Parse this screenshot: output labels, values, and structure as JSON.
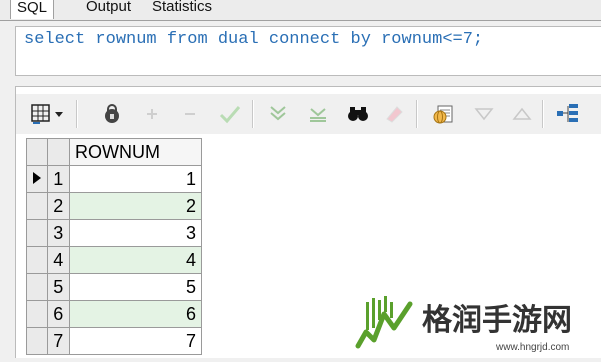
{
  "tabs": [
    {
      "label": "SQL"
    },
    {
      "label": "Output"
    },
    {
      "label": "Statistics"
    }
  ],
  "editor": {
    "text_segments": [
      "select ",
      "rownum ",
      "from ",
      "dual ",
      "connect ",
      "by ",
      "rownum<=7;"
    ]
  },
  "toolbar": {
    "icons": [
      "grid-columns-icon",
      "dropdown-icon",
      "lock-icon",
      "plus-icon",
      "minus-icon",
      "check-icon",
      "filter-down-icon",
      "filter-clear-icon",
      "binoculars-icon",
      "eraser-icon",
      "export-icon",
      "triangle-down-icon",
      "triangle-up-icon",
      "tree-icon"
    ]
  },
  "grid": {
    "column_header": "ROWNUM",
    "rows": [
      {
        "num": "1",
        "value": "1"
      },
      {
        "num": "2",
        "value": "2"
      },
      {
        "num": "3",
        "value": "3"
      },
      {
        "num": "4",
        "value": "4"
      },
      {
        "num": "5",
        "value": "5"
      },
      {
        "num": "6",
        "value": "6"
      },
      {
        "num": "7",
        "value": "7"
      }
    ]
  },
  "watermark": {
    "title": "格润手游网",
    "url": "www.hngrjd.com",
    "colors": {
      "green": "#5aa02c",
      "dark": "#333333"
    }
  }
}
